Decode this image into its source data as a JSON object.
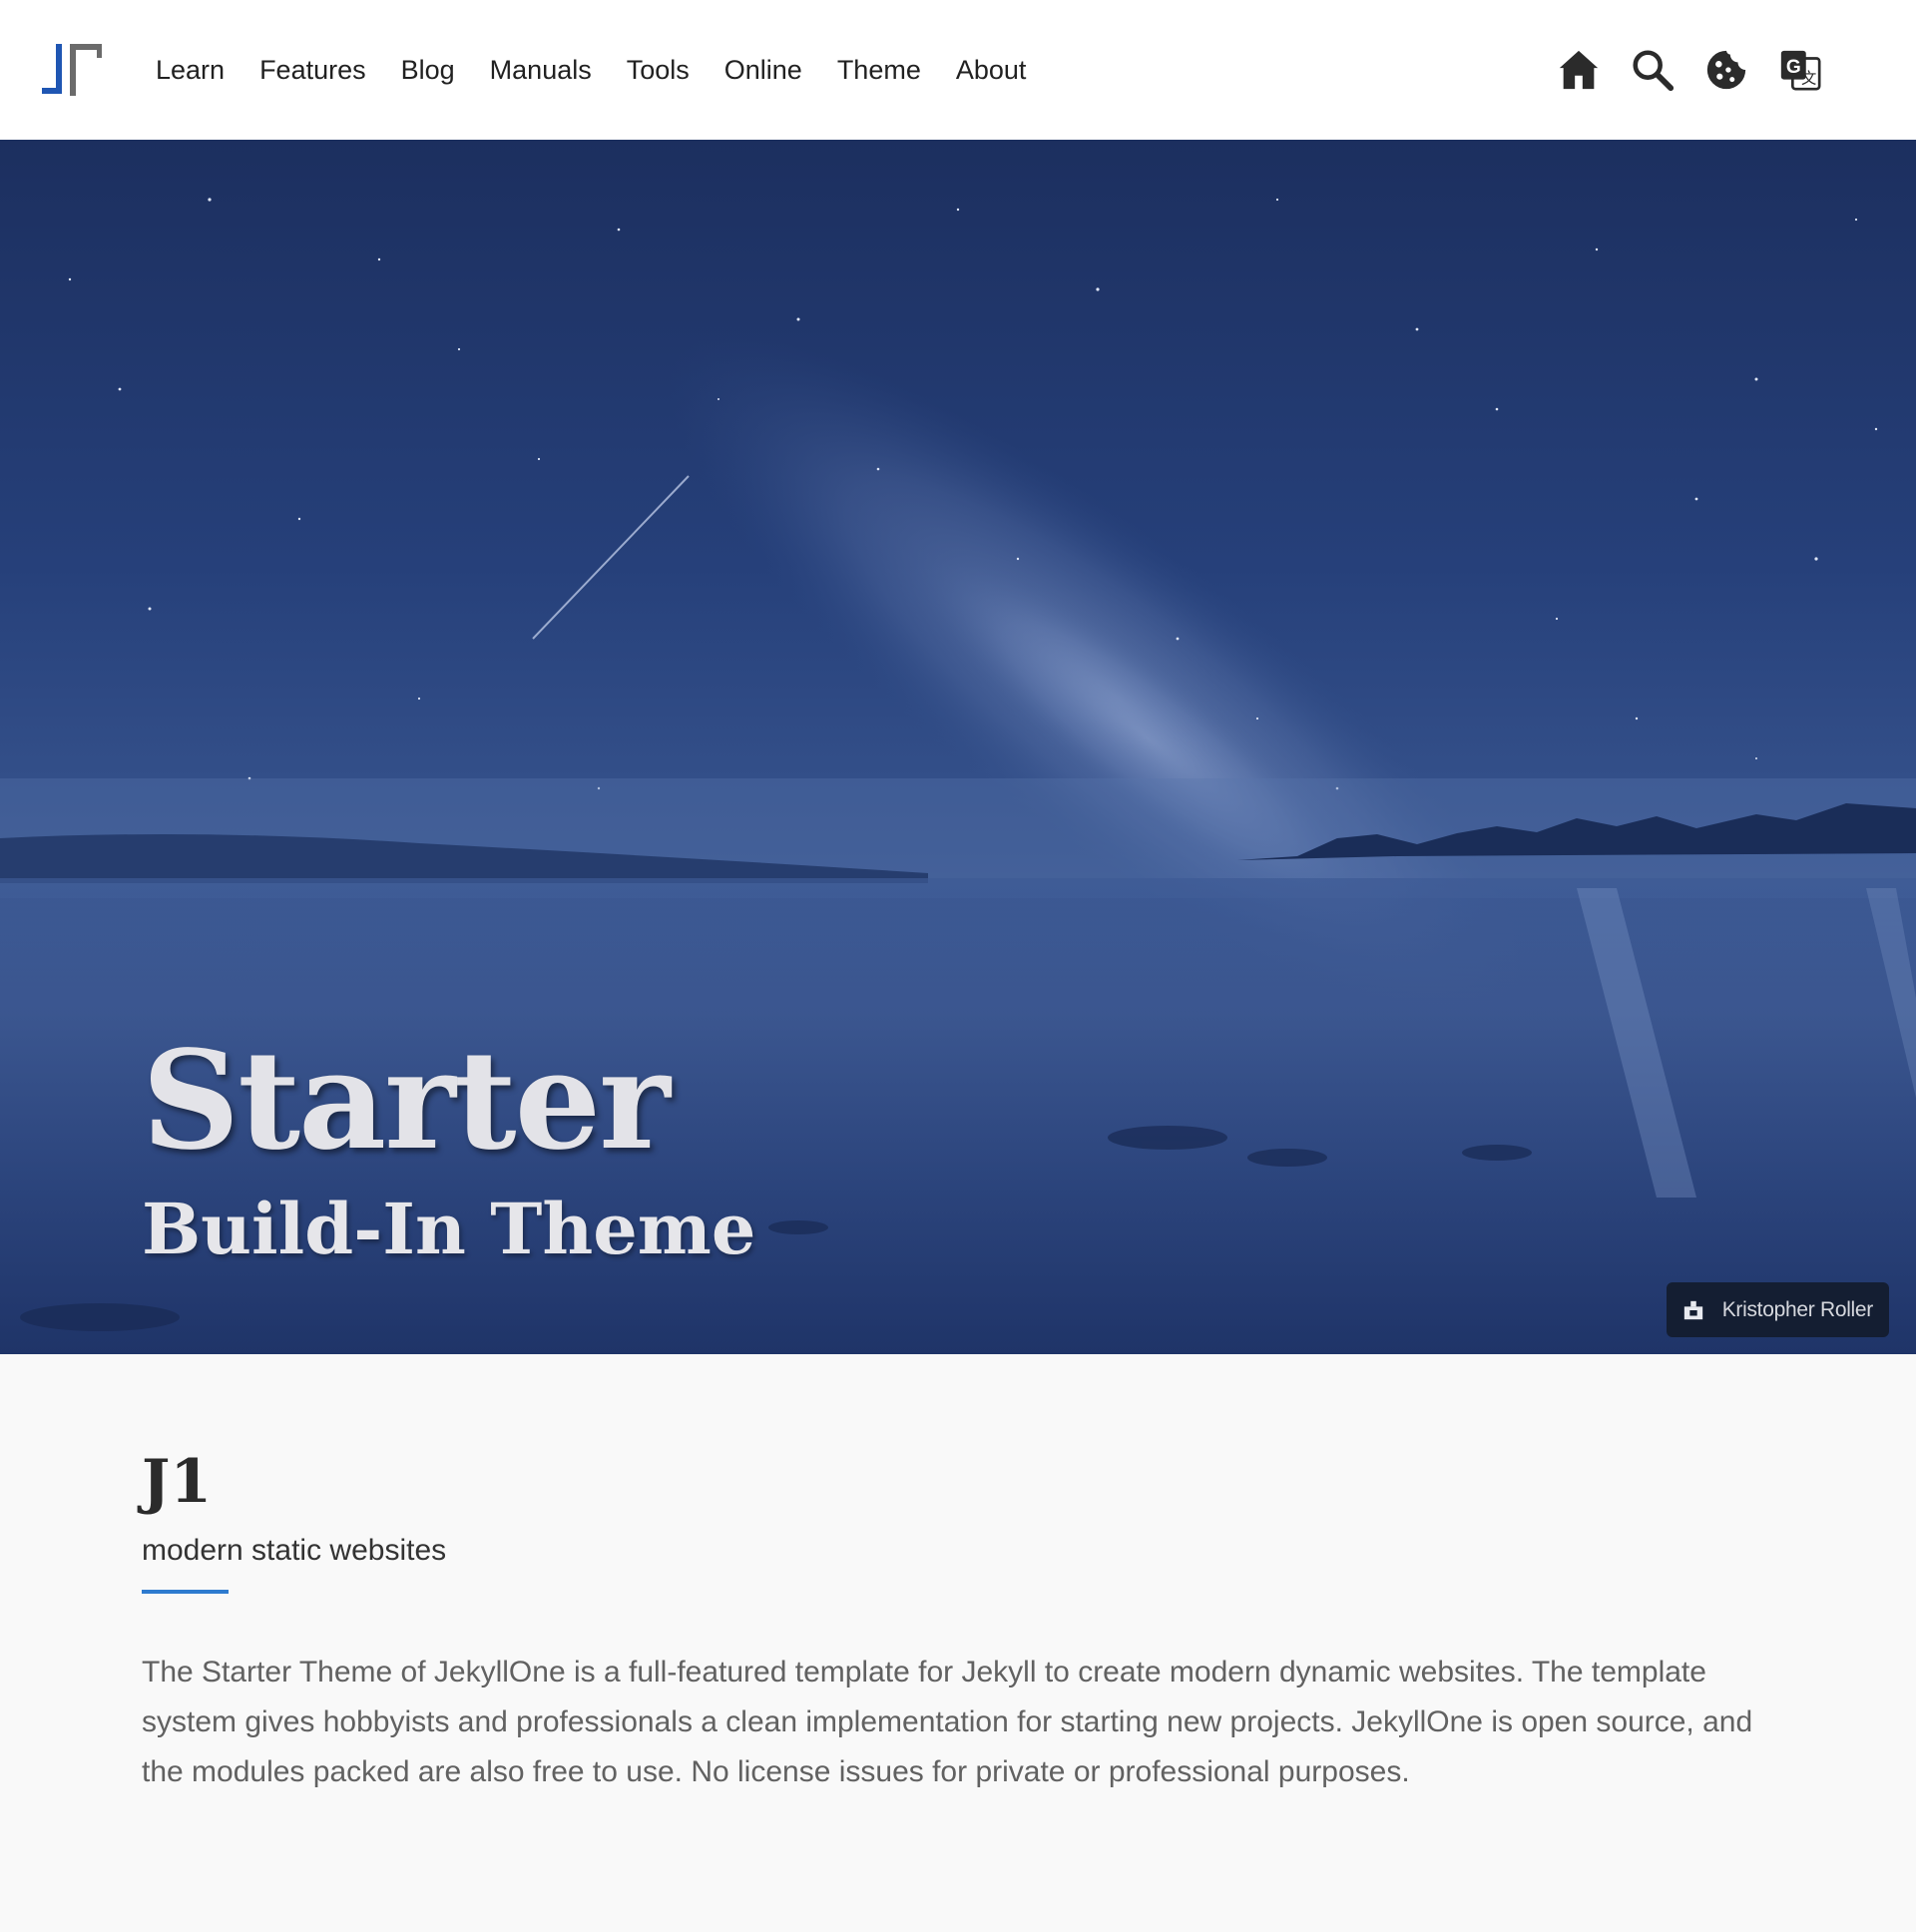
{
  "navbar": {
    "brand_name": "J1",
    "menu": [
      "Learn",
      "Features",
      "Blog",
      "Manuals",
      "Tools",
      "Online",
      "Theme",
      "About"
    ],
    "icons": [
      "home-icon",
      "search-icon",
      "cookie-icon",
      "translate-icon"
    ]
  },
  "hero": {
    "title": "Starter",
    "subtitle": "Build-In Theme",
    "photo_credit": "Kristopher Roller",
    "overlay_color": "#26407a"
  },
  "content": {
    "title": "J1",
    "subtitle": "modern static websites",
    "accent_color": "#2e7bcf",
    "text": "The Starter Theme of JekyllOne is a full-featured template for Jekyll to create modern dynamic websites. The template system gives hobbyists and professionals a clean implementation for starting new projects. JekyllOne is open source, and the modules packed are also free to use. No license issues for private or professional purposes."
  }
}
